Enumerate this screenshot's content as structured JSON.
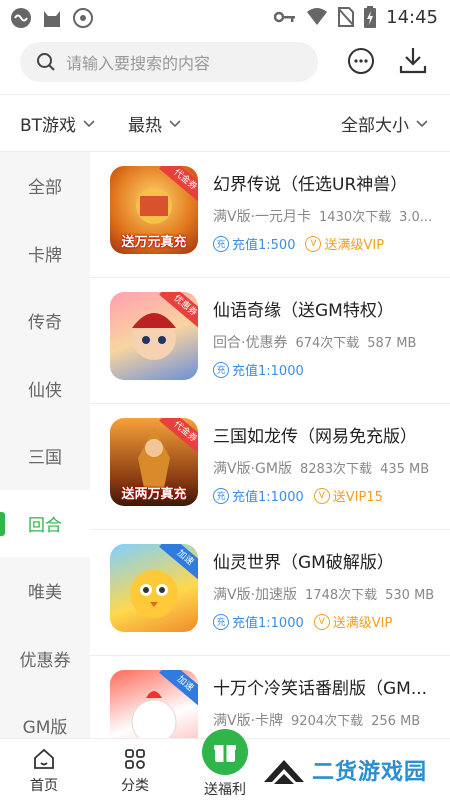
{
  "status": {
    "time": "14:45"
  },
  "search": {
    "placeholder": "请输入要搜索的内容"
  },
  "filters": [
    {
      "label": "BT游戏"
    },
    {
      "label": "最热"
    },
    {
      "label": "全部大小"
    }
  ],
  "sidebar": {
    "items": [
      {
        "label": "全部"
      },
      {
        "label": "卡牌"
      },
      {
        "label": "传奇"
      },
      {
        "label": "仙侠"
      },
      {
        "label": "三国"
      },
      {
        "label": "回合"
      },
      {
        "label": "唯美"
      },
      {
        "label": "优惠券"
      },
      {
        "label": "GM版"
      }
    ],
    "active_index": 5
  },
  "games": [
    {
      "title": "幻界传说（任选UR神兽）",
      "meta": "满V版·一元月卡",
      "downloads": "1430次下载",
      "size": "3.0...",
      "tags": [
        {
          "icon": "充",
          "text": "充值1:500"
        },
        {
          "icon": "V",
          "text": "送满级VIP"
        }
      ],
      "icon_ribbon": "代金券",
      "icon_caption": "送万元真充"
    },
    {
      "title": "仙语奇缘（送GM特权）",
      "meta": "回合·优惠券",
      "downloads": "674次下载",
      "size": "587 MB",
      "tags": [
        {
          "icon": "充",
          "text": "充值1:1000"
        }
      ],
      "icon_ribbon": "优惠券",
      "icon_caption": ""
    },
    {
      "title": "三国如龙传（网易免充版）",
      "meta": "满V版·GM版",
      "downloads": "8283次下载",
      "size": "435 MB",
      "tags": [
        {
          "icon": "充",
          "text": "充值1:1000"
        },
        {
          "icon": "V",
          "text": "送VIP15"
        }
      ],
      "icon_ribbon": "代金券",
      "icon_caption": "送两万真充"
    },
    {
      "title": "仙灵世界（GM破解版）",
      "meta": "满V版·加速版",
      "downloads": "1748次下载",
      "size": "530 MB",
      "tags": [
        {
          "icon": "充",
          "text": "充值1:1000"
        },
        {
          "icon": "V",
          "text": "送满级VIP"
        }
      ],
      "icon_ribbon": "加速",
      "icon_caption": ""
    },
    {
      "title": "十万个冷笑话番剧版（GM...",
      "meta": "满V版·卡牌",
      "downloads": "9204次下载",
      "size": "256 MB",
      "tags": [],
      "icon_ribbon": "加速",
      "icon_caption": ""
    }
  ],
  "bottom_nav": [
    {
      "label": "首页"
    },
    {
      "label": "分类"
    },
    {
      "label": "送福利"
    }
  ],
  "watermark": {
    "text": "二货游戏园"
  },
  "colors": {
    "accent": "#2fb54a",
    "link_blue": "#3a8ee6",
    "vip_gold": "#f0a020"
  }
}
